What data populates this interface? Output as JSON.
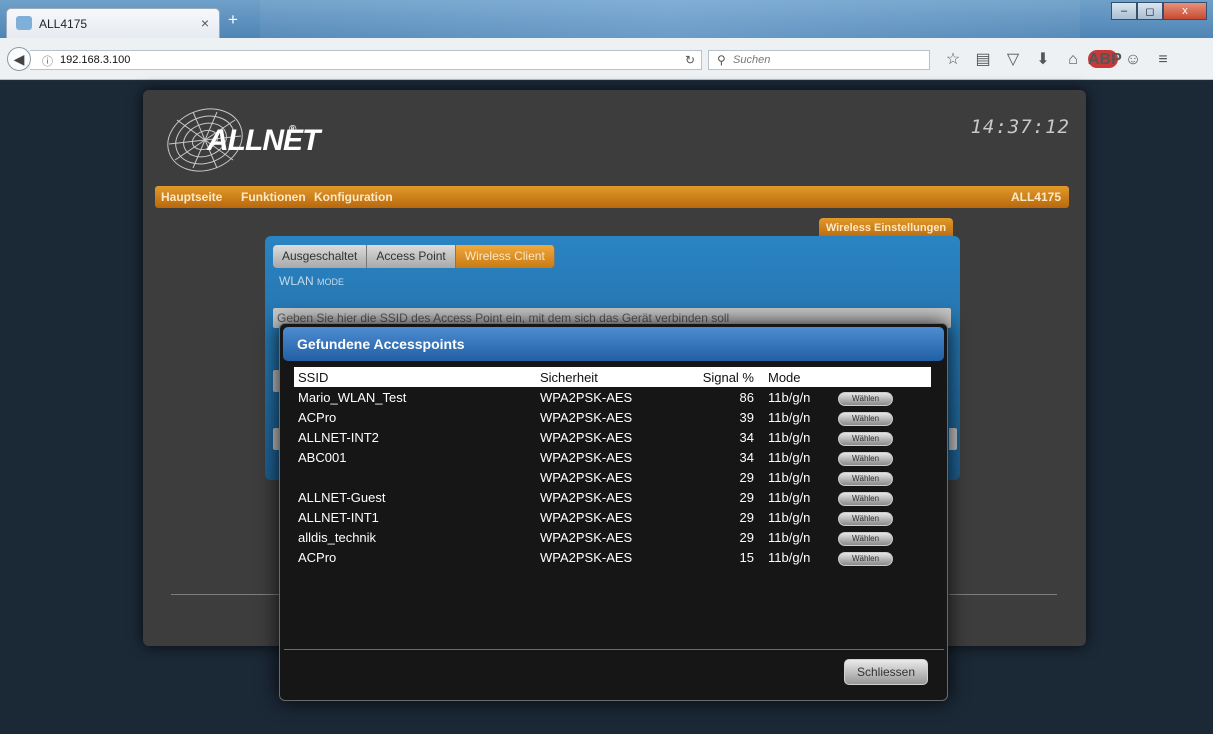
{
  "browser": {
    "tab_title": "ALL4175",
    "tab_close": "×",
    "new_tab": "+",
    "url": "192.168.3.100",
    "search_placeholder": "Suchen",
    "icons": [
      "back-arrow-icon",
      "info-icon",
      "reload-icon",
      "search-icon",
      "bookmark-star-icon",
      "reading-list-icon",
      "pocket-icon",
      "download-icon",
      "home-icon",
      "adblock-icon",
      "chat-icon",
      "menu-icon"
    ]
  },
  "window": {
    "minimize": "–",
    "maximize": "◻",
    "close": "x"
  },
  "device": {
    "brand": "ALLNET",
    "trademark": "®",
    "time": "14:37:12",
    "model": "ALL4175"
  },
  "menu": [
    "Hauptseite",
    "Funktionen",
    "Konfiguration"
  ],
  "wireless": {
    "section_label": "Wireless Einstellungen",
    "modes": [
      "Ausgeschaltet",
      "Access Point",
      "Wireless Client"
    ],
    "active_mode": "Wireless Client",
    "mode_label_main": "WLAN",
    "mode_label_small": "MODE",
    "ssid_hint": "Geben Sie hier die SSID des Access Point ein, mit dem sich das Gerät verbinden soll"
  },
  "modal": {
    "title": "Gefundene Accesspoints",
    "columns": [
      "SSID",
      "Sicherheit",
      "Signal %",
      "Mode",
      ""
    ],
    "choose_label": "Wählen",
    "close_label": "Schliessen",
    "rows": [
      {
        "ssid": "Mario_WLAN_Test",
        "security": "WPA2PSK-AES",
        "signal": "86",
        "mode": "11b/g/n"
      },
      {
        "ssid": "ACPro",
        "security": "WPA2PSK-AES",
        "signal": "39",
        "mode": "11b/g/n"
      },
      {
        "ssid": "ALLNET-INT2",
        "security": "WPA2PSK-AES",
        "signal": "34",
        "mode": "11b/g/n"
      },
      {
        "ssid": "ABC001",
        "security": "WPA2PSK-AES",
        "signal": "34",
        "mode": "11b/g/n"
      },
      {
        "ssid": "",
        "security": "WPA2PSK-AES",
        "signal": "29",
        "mode": "11b/g/n"
      },
      {
        "ssid": "ALLNET-Guest",
        "security": "WPA2PSK-AES",
        "signal": "29",
        "mode": "11b/g/n"
      },
      {
        "ssid": "ALLNET-INT1",
        "security": "WPA2PSK-AES",
        "signal": "29",
        "mode": "11b/g/n"
      },
      {
        "ssid": "alldis_technik",
        "security": "WPA2PSK-AES",
        "signal": "29",
        "mode": "11b/g/n"
      },
      {
        "ssid": "ACPro",
        "security": "WPA2PSK-AES",
        "signal": "15",
        "mode": "11b/g/n"
      }
    ]
  },
  "colors": {
    "accent_orange": "#c77b14",
    "panel_blue": "#2a84c3",
    "modal_head": "#2260a5"
  }
}
